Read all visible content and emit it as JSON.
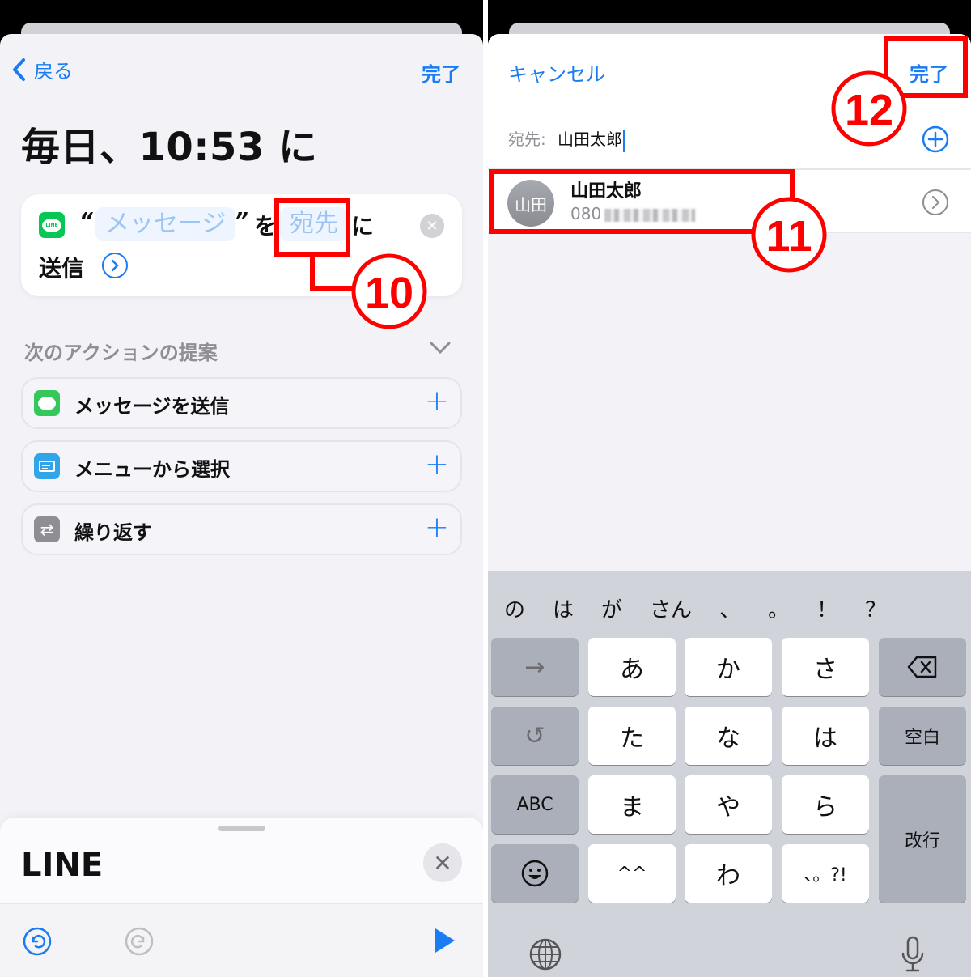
{
  "left": {
    "nav": {
      "back_label": "戻る",
      "done_label": "完了"
    },
    "title": "毎日、10:53 に",
    "action": {
      "app_icon": "line-app-icon",
      "app_icon_text": "LINE",
      "quote_open": "“",
      "message_token": "メッセージ",
      "quote_close": "”",
      "particle_wo": "を",
      "recipient_token": "宛先",
      "particle_ni": "に",
      "verb": "送信"
    },
    "suggestions": {
      "header": "次のアクションの提案",
      "items": [
        {
          "label": "メッセージを送信",
          "icon": "messages-icon",
          "color": "#34c759"
        },
        {
          "label": "メニューから選択",
          "icon": "menu-icon",
          "color": "#32a5e8"
        },
        {
          "label": "繰り返す",
          "icon": "repeat-icon",
          "color": "#8e8e93"
        }
      ]
    },
    "bottom_sheet": {
      "title": "LINE",
      "close": "✕"
    },
    "annotation": "⑩"
  },
  "right": {
    "nav": {
      "cancel_label": "キャンセル",
      "done_label": "完了"
    },
    "to": {
      "label": "宛先:",
      "value": "山田太郎"
    },
    "contact": {
      "avatar": "山田",
      "name": "山田太郎",
      "phone_prefix": "080"
    },
    "keyboard": {
      "candidates": [
        "の",
        "は",
        "が",
        "さん",
        "、",
        "。",
        "！",
        "？"
      ],
      "rows": [
        [
          "→",
          "あ",
          "か",
          "さ",
          "⌫"
        ],
        [
          "↺",
          "た",
          "な",
          "は",
          "空白"
        ],
        [
          "ABC",
          "ま",
          "や",
          "ら",
          "改行"
        ],
        [
          "☺",
          "^^",
          "わ",
          "、。?!"
        ]
      ]
    },
    "annotations": {
      "contact": "⑪",
      "done": "⑫"
    }
  },
  "colors": {
    "accent": "#1a7cf2",
    "annotation": "#ff0000",
    "line_green": "#06c755"
  }
}
